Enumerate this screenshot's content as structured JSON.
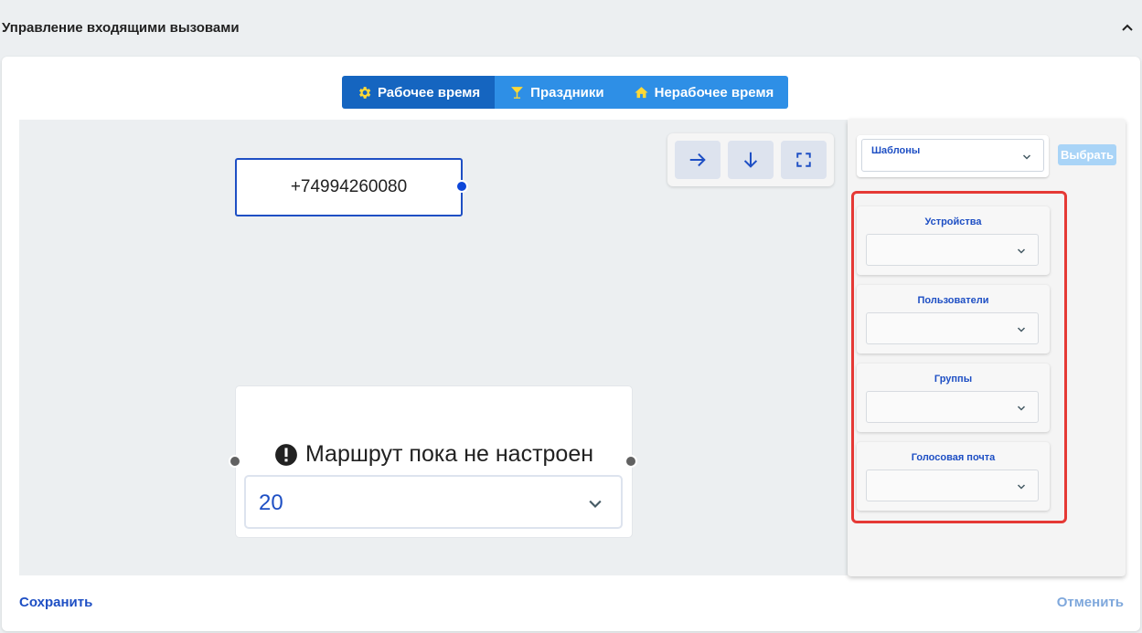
{
  "header": {
    "title": "Управление входящими вызовами"
  },
  "tabs": [
    {
      "label": "Рабочее время",
      "icon": "gear-icon",
      "active": true
    },
    {
      "label": "Праздники",
      "icon": "cocktail-icon",
      "active": false
    },
    {
      "label": "Нерабочее время",
      "icon": "home-icon",
      "active": false
    }
  ],
  "toolbar": {
    "buttons": [
      "arrow-right-icon",
      "arrow-down-icon",
      "fullscreen-icon"
    ]
  },
  "canvas": {
    "phone_node": {
      "number": "+74994260080"
    },
    "route_node": {
      "title": "Маршрут пока не настроен",
      "select_value": "20"
    }
  },
  "panel": {
    "templates": {
      "label": "Шаблоны",
      "button": "Выбрать"
    },
    "groups": [
      {
        "label": "Устройства"
      },
      {
        "label": "Пользователи"
      },
      {
        "label": "Группы"
      },
      {
        "label": "Голосовая почта"
      }
    ]
  },
  "actions": {
    "save": "Сохранить",
    "cancel": "Отменить"
  },
  "colors": {
    "primary": "#1565c0",
    "tab": "#2e8fe6",
    "accent_icon": "#fdd835",
    "highlight": "#e53935"
  }
}
